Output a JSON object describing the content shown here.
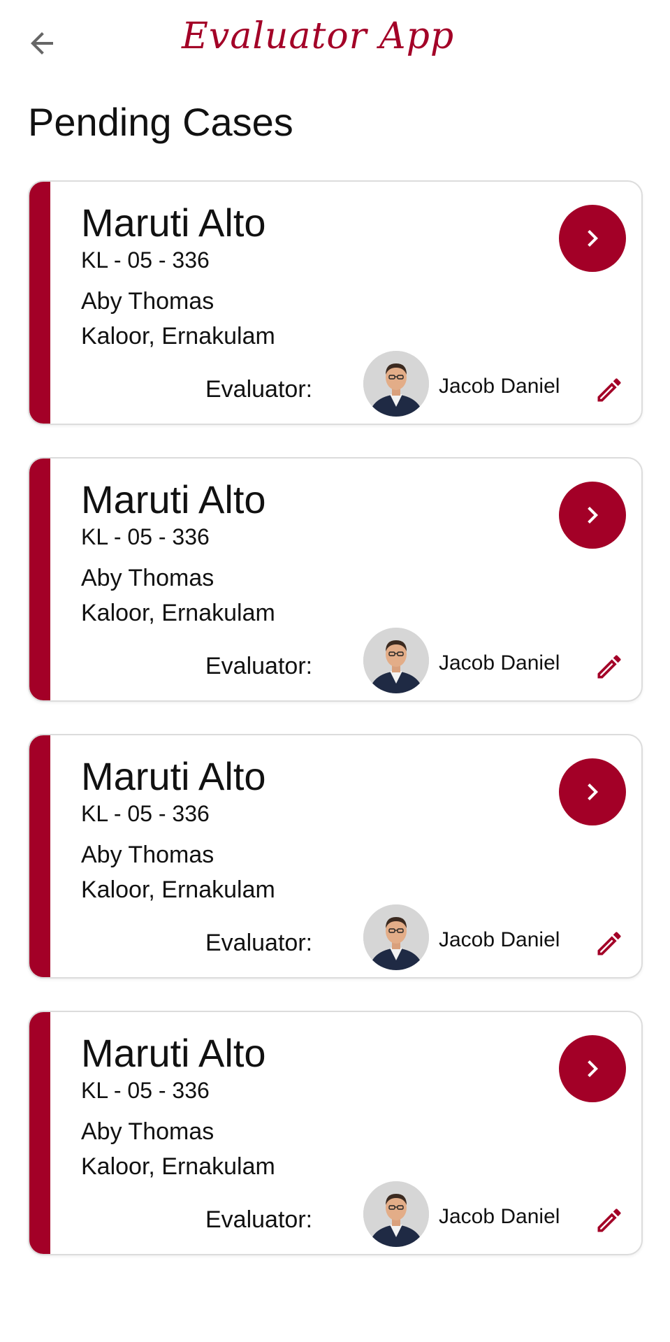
{
  "header": {
    "title": "Evaluator App",
    "back_icon": "arrow-left-icon"
  },
  "page": {
    "title": "Pending Cases"
  },
  "colors": {
    "accent": "#a30027",
    "card_border": "#dcdcdc"
  },
  "cases": [
    {
      "car": "Maruti Alto",
      "registration": "KL - 05 - 336",
      "owner": "Aby Thomas",
      "location": "Kaloor, Ernakulam",
      "evaluator_label": "Evaluator:",
      "evaluator_name": "Jacob Daniel"
    },
    {
      "car": "Maruti Alto",
      "registration": "KL - 05 - 336",
      "owner": "Aby Thomas",
      "location": "Kaloor, Ernakulam",
      "evaluator_label": "Evaluator:",
      "evaluator_name": "Jacob Daniel"
    },
    {
      "car": "Maruti Alto",
      "registration": "KL - 05 - 336",
      "owner": "Aby Thomas",
      "location": "Kaloor, Ernakulam",
      "evaluator_label": "Evaluator:",
      "evaluator_name": "Jacob Daniel"
    },
    {
      "car": "Maruti Alto",
      "registration": "KL - 05 - 336",
      "owner": "Aby Thomas",
      "location": "Kaloor, Ernakulam",
      "evaluator_label": "Evaluator:",
      "evaluator_name": "Jacob Daniel"
    }
  ]
}
